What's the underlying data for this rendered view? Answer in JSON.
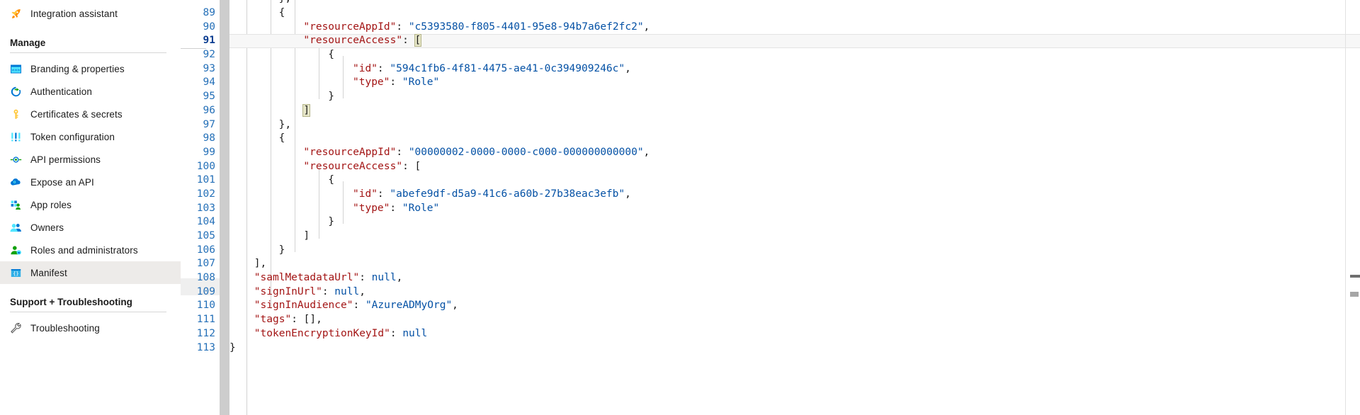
{
  "sidebar": {
    "items_top": [
      {
        "label": "Integration assistant",
        "icon": "rocket-icon",
        "selected": false
      }
    ],
    "section_manage": {
      "title": "Manage",
      "items": [
        {
          "label": "Branding & properties",
          "icon": "branding-icon",
          "selected": false
        },
        {
          "label": "Authentication",
          "icon": "authentication-icon",
          "selected": false
        },
        {
          "label": "Certificates & secrets",
          "icon": "key-icon",
          "selected": false
        },
        {
          "label": "Token configuration",
          "icon": "token-icon",
          "selected": false
        },
        {
          "label": "API permissions",
          "icon": "api-permissions-icon",
          "selected": false
        },
        {
          "label": "Expose an API",
          "icon": "cloud-api-icon",
          "selected": false
        },
        {
          "label": "App roles",
          "icon": "app-roles-icon",
          "selected": false
        },
        {
          "label": "Owners",
          "icon": "owners-icon",
          "selected": false
        },
        {
          "label": "Roles and administrators",
          "icon": "roles-admin-icon",
          "selected": false
        },
        {
          "label": "Manifest",
          "icon": "manifest-icon",
          "selected": true
        }
      ]
    },
    "section_support": {
      "title": "Support + Troubleshooting",
      "items": [
        {
          "label": "Troubleshooting",
          "icon": "wrench-icon",
          "selected": false
        }
      ]
    }
  },
  "editor": {
    "active_line": 91,
    "colors": {
      "key": "#a31515",
      "string": "#0451a5",
      "punctuation": "#1b1b1b",
      "line_number": "#2570b8",
      "active_line_bg": "#f7f7f7",
      "bracket_match_bg": "#e6e6c8"
    },
    "lines": [
      {
        "n": 89,
        "indent": 8,
        "tokens": [
          {
            "t": "punc",
            "v": "{"
          }
        ]
      },
      {
        "n": 90,
        "indent": 12,
        "tokens": [
          {
            "t": "key",
            "v": "\"resourceAppId\""
          },
          {
            "t": "punc",
            "v": ": "
          },
          {
            "t": "str",
            "v": "\"c5393580-f805-4401-95e8-94b7a6ef2fc2\""
          },
          {
            "t": "punc",
            "v": ","
          }
        ]
      },
      {
        "n": 91,
        "indent": 12,
        "tokens": [
          {
            "t": "key",
            "v": "\"resourceAccess\""
          },
          {
            "t": "punc",
            "v": ": "
          },
          {
            "t": "brk",
            "v": "["
          }
        ]
      },
      {
        "n": 92,
        "indent": 16,
        "tokens": [
          {
            "t": "punc",
            "v": "{"
          }
        ]
      },
      {
        "n": 93,
        "indent": 20,
        "tokens": [
          {
            "t": "key",
            "v": "\"id\""
          },
          {
            "t": "punc",
            "v": ": "
          },
          {
            "t": "str",
            "v": "\"594c1fb6-4f81-4475-ae41-0c394909246c\""
          },
          {
            "t": "punc",
            "v": ","
          }
        ]
      },
      {
        "n": 94,
        "indent": 20,
        "tokens": [
          {
            "t": "key",
            "v": "\"type\""
          },
          {
            "t": "punc",
            "v": ": "
          },
          {
            "t": "str",
            "v": "\"Role\""
          }
        ]
      },
      {
        "n": 95,
        "indent": 16,
        "tokens": [
          {
            "t": "punc",
            "v": "}"
          }
        ]
      },
      {
        "n": 96,
        "indent": 12,
        "tokens": [
          {
            "t": "brk",
            "v": "]"
          }
        ]
      },
      {
        "n": 97,
        "indent": 8,
        "tokens": [
          {
            "t": "punc",
            "v": "},"
          }
        ]
      },
      {
        "n": 98,
        "indent": 8,
        "tokens": [
          {
            "t": "punc",
            "v": "{"
          }
        ]
      },
      {
        "n": 99,
        "indent": 12,
        "tokens": [
          {
            "t": "key",
            "v": "\"resourceAppId\""
          },
          {
            "t": "punc",
            "v": ": "
          },
          {
            "t": "str",
            "v": "\"00000002-0000-0000-c000-000000000000\""
          },
          {
            "t": "punc",
            "v": ","
          }
        ]
      },
      {
        "n": 100,
        "indent": 12,
        "tokens": [
          {
            "t": "key",
            "v": "\"resourceAccess\""
          },
          {
            "t": "punc",
            "v": ": "
          },
          {
            "t": "punc",
            "v": "["
          }
        ]
      },
      {
        "n": 101,
        "indent": 16,
        "tokens": [
          {
            "t": "punc",
            "v": "{"
          }
        ]
      },
      {
        "n": 102,
        "indent": 20,
        "tokens": [
          {
            "t": "key",
            "v": "\"id\""
          },
          {
            "t": "punc",
            "v": ": "
          },
          {
            "t": "str",
            "v": "\"abefe9df-d5a9-41c6-a60b-27b38eac3efb\""
          },
          {
            "t": "punc",
            "v": ","
          }
        ]
      },
      {
        "n": 103,
        "indent": 20,
        "tokens": [
          {
            "t": "key",
            "v": "\"type\""
          },
          {
            "t": "punc",
            "v": ": "
          },
          {
            "t": "str",
            "v": "\"Role\""
          }
        ]
      },
      {
        "n": 104,
        "indent": 16,
        "tokens": [
          {
            "t": "punc",
            "v": "}"
          }
        ]
      },
      {
        "n": 105,
        "indent": 12,
        "tokens": [
          {
            "t": "punc",
            "v": "]"
          }
        ]
      },
      {
        "n": 106,
        "indent": 8,
        "tokens": [
          {
            "t": "punc",
            "v": "}"
          }
        ]
      },
      {
        "n": 107,
        "indent": 4,
        "tokens": [
          {
            "t": "punc",
            "v": "],"
          }
        ]
      },
      {
        "n": 108,
        "indent": 4,
        "tokens": [
          {
            "t": "key",
            "v": "\"samlMetadataUrl\""
          },
          {
            "t": "punc",
            "v": ": "
          },
          {
            "t": "kw",
            "v": "null"
          },
          {
            "t": "punc",
            "v": ","
          }
        ]
      },
      {
        "n": 109,
        "indent": 4,
        "tokens": [
          {
            "t": "key",
            "v": "\"signInUrl\""
          },
          {
            "t": "punc",
            "v": ": "
          },
          {
            "t": "kw",
            "v": "null"
          },
          {
            "t": "punc",
            "v": ","
          }
        ]
      },
      {
        "n": 110,
        "indent": 4,
        "tokens": [
          {
            "t": "key",
            "v": "\"signInAudience\""
          },
          {
            "t": "punc",
            "v": ": "
          },
          {
            "t": "str",
            "v": "\"AzureADMyOrg\""
          },
          {
            "t": "punc",
            "v": ","
          }
        ]
      },
      {
        "n": 111,
        "indent": 4,
        "tokens": [
          {
            "t": "key",
            "v": "\"tags\""
          },
          {
            "t": "punc",
            "v": ": "
          },
          {
            "t": "punc",
            "v": "[],"
          }
        ]
      },
      {
        "n": 112,
        "indent": 4,
        "tokens": [
          {
            "t": "key",
            "v": "\"tokenEncryptionKeyId\""
          },
          {
            "t": "punc",
            "v": ": "
          },
          {
            "t": "kw",
            "v": "null"
          }
        ]
      },
      {
        "n": 113,
        "indent": 0,
        "tokens": [
          {
            "t": "punc",
            "v": "}"
          }
        ]
      }
    ],
    "partial_top_line": {
      "indent": 8,
      "text": "},"
    }
  }
}
